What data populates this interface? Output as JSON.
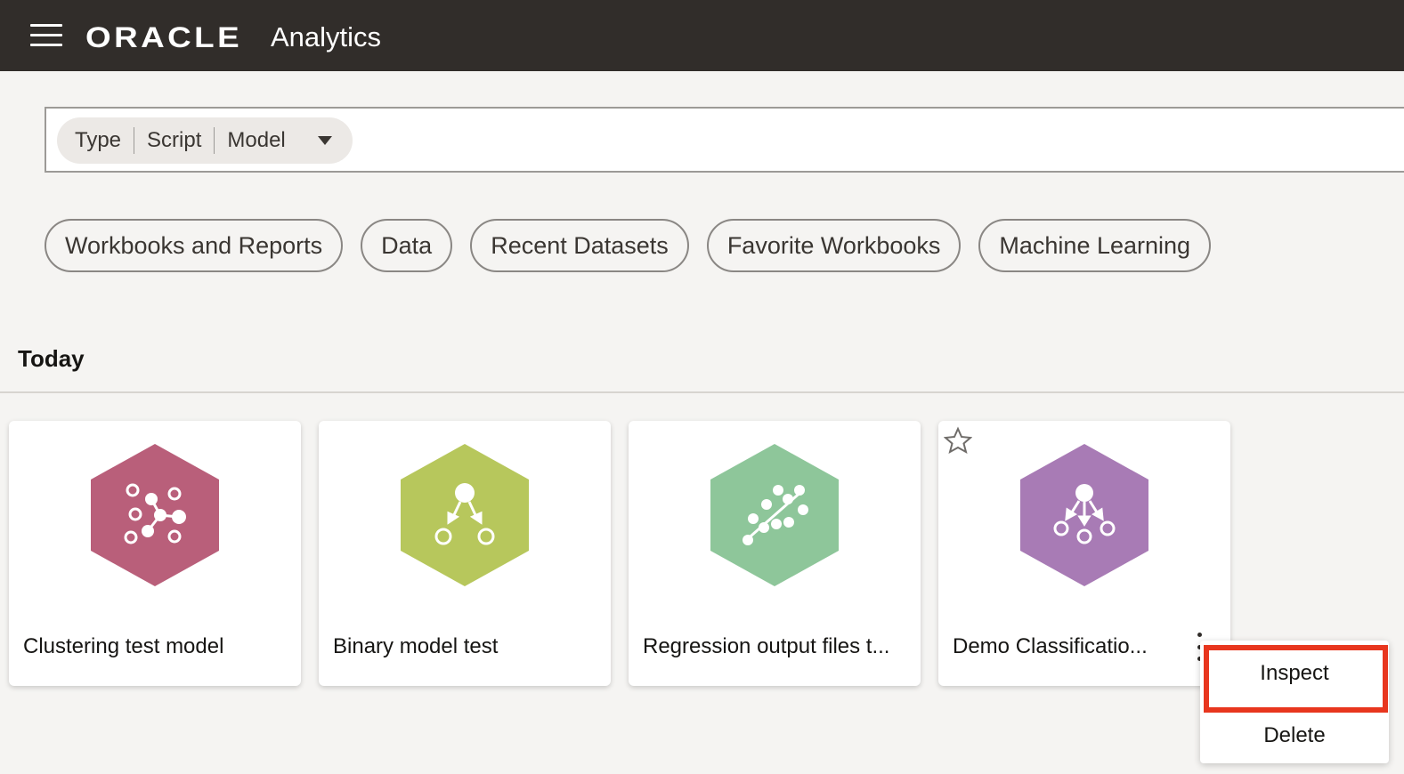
{
  "app": {
    "brand_logo": "ORACLE",
    "product_name": "Analytics"
  },
  "search": {
    "type_label": "Type",
    "script_label": "Script",
    "model_label": "Model"
  },
  "chips": [
    {
      "label": "Workbooks and Reports"
    },
    {
      "label": "Data"
    },
    {
      "label": "Recent Datasets"
    },
    {
      "label": "Favorite Workbooks"
    },
    {
      "label": "Machine Learning"
    }
  ],
  "section": {
    "title": "Today"
  },
  "cards": [
    {
      "title": "Clustering test model",
      "icon": "clustering-icon",
      "color": "#b95f7a"
    },
    {
      "title": "Binary model test",
      "icon": "binary-classification-icon",
      "color": "#b7c75c"
    },
    {
      "title": "Regression output files t...",
      "icon": "regression-icon",
      "color": "#8ec69a"
    },
    {
      "title": "Demo Classificatio...",
      "icon": "multi-classification-icon",
      "color": "#a87bb5"
    }
  ],
  "context_menu": {
    "items": [
      {
        "label": "Inspect"
      },
      {
        "label": "Delete"
      }
    ],
    "highlight_color": "#e8361e"
  }
}
